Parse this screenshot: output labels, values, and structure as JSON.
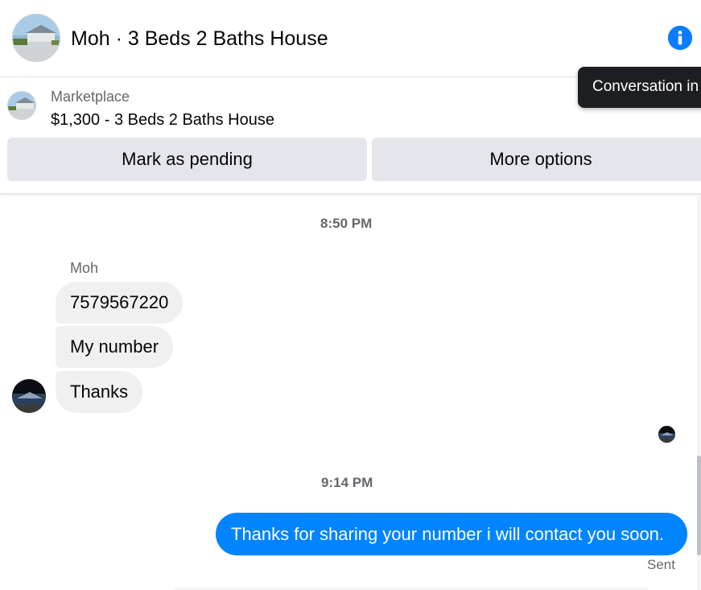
{
  "header": {
    "title": "Moh · 3 Beds 2 Baths House",
    "info_icon": "info-icon"
  },
  "tooltip": {
    "text": "Conversation in"
  },
  "marketplace": {
    "label": "Marketplace",
    "listing": "$1,300 - 3 Beds 2 Baths House",
    "buttons": {
      "pending": "Mark as pending",
      "more": "More options"
    }
  },
  "thread": {
    "timestamps": [
      "8:50 PM",
      "9:14 PM"
    ],
    "sender_name": "Moh",
    "incoming": [
      "7579567220",
      "My number",
      "Thanks"
    ],
    "outgoing": "Thanks for sharing your number i will contact you soon.",
    "status": "Sent"
  },
  "colors": {
    "accent": "#0084ff",
    "info": "#0a7cff",
    "incoming_bubble": "#f0f0f0",
    "button_bg": "#e4e6eb",
    "muted_text": "#65676b"
  }
}
